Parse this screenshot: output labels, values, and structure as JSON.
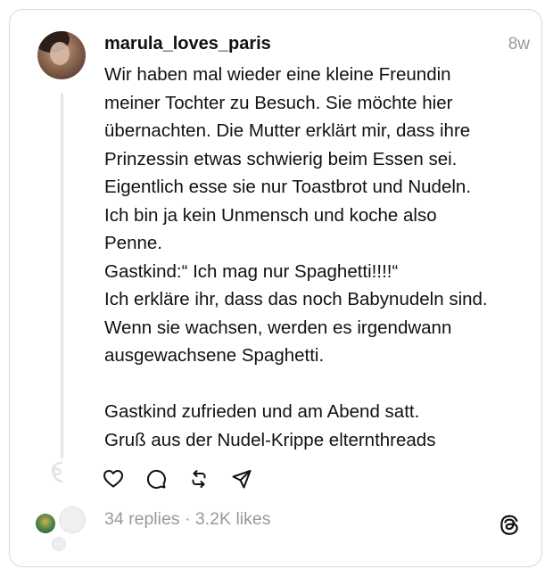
{
  "post": {
    "username": "marula_loves_paris",
    "time": "8w",
    "text": "Wir haben mal wieder eine kleine Freundin\nmeiner Tochter zu Besuch. Sie möchte hier\nübernachten. Die Mutter erklärt mir, dass ihre\nPrinzessin etwas schwierig beim Essen sei.\nEigentlich esse sie nur Toastbrot und Nudeln.\nIch bin ja kein Unmensch und koche also\nPenne.\nGastkind:“ Ich mag nur Spaghetti!!!!“\nIch erkläre ihr, dass das noch Babynudeln sind.\nWenn sie wachsen, werden es irgendwann\nausgewachsene Spaghetti.\n\nGastkind zufrieden und am Abend satt.\nGruß aus der Nudel-Krippe elternthreads"
  },
  "stats": {
    "replies": "34 replies",
    "separator": "·",
    "likes": "3.2K likes"
  },
  "actions": {
    "like_icon": "heart-icon",
    "reply_icon": "comment-icon",
    "repost_icon": "repost-icon",
    "share_icon": "send-icon"
  },
  "brand": {
    "logo_icon": "threads-logo-icon"
  }
}
